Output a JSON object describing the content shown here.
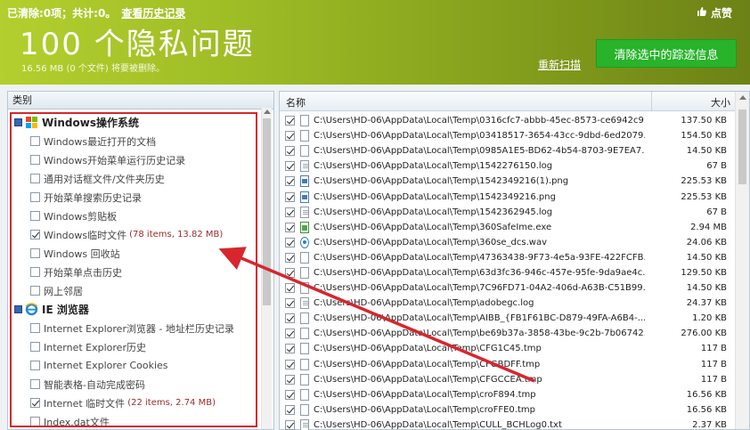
{
  "header": {
    "summary": "已清除:0项；共计:0。",
    "history_link": "查看历史记录",
    "title": "100 个隐私问题",
    "subtext": "16.56 MB (0 个文件) 将要被删除。",
    "like_label": "点赞",
    "rescan_label": "重新扫描",
    "clean_button": "清除选中的踪迹信息"
  },
  "left_panel": {
    "header": "类别",
    "groups": [
      {
        "label": "Windows操作系统",
        "icon": "windows-logo-icon",
        "items": [
          {
            "label": "Windows最近打开的文档",
            "checked": false,
            "count": ""
          },
          {
            "label": "Windows开始菜单运行历史记录",
            "checked": false,
            "count": ""
          },
          {
            "label": "通用对话框文件/文件夹历史",
            "checked": false,
            "count": ""
          },
          {
            "label": "开始菜单搜索历史记录",
            "checked": false,
            "count": ""
          },
          {
            "label": "Windows剪贴板",
            "checked": false,
            "count": ""
          },
          {
            "label": "Windows临时文件",
            "checked": true,
            "count": "(78 items, 13.82 MB)"
          },
          {
            "label": "Windows 回收站",
            "checked": false,
            "count": ""
          },
          {
            "label": "开始菜单点击历史",
            "checked": false,
            "count": ""
          },
          {
            "label": "网上邻居",
            "checked": false,
            "count": ""
          }
        ]
      },
      {
        "label": "IE 浏览器",
        "icon": "internet-explorer-icon",
        "items": [
          {
            "label": "Internet Explorer浏览器 - 地址栏历史记录",
            "checked": false,
            "count": ""
          },
          {
            "label": "Internet Explorer历史",
            "checked": false,
            "count": ""
          },
          {
            "label": "Internet Explorer Cookies",
            "checked": false,
            "count": ""
          },
          {
            "label": "智能表格-自动完成密码",
            "checked": false,
            "count": ""
          },
          {
            "label": "Internet 临时文件",
            "checked": true,
            "count": "(22 items, 2.74 MB)"
          },
          {
            "label": "Index.dat文件",
            "checked": false,
            "count": ""
          }
        ]
      }
    ]
  },
  "right_panel": {
    "col_name": "名称",
    "col_size": "大小",
    "rows": [
      {
        "path": "C:\\Users\\HD-06\\AppData\\Local\\Temp\\0316cfc7-abbb-45ec-8573-ce6942c9...",
        "size": "137.50 KB",
        "icon": "doc"
      },
      {
        "path": "C:\\Users\\HD-06\\AppData\\Local\\Temp\\03418517-3654-43cc-9dbd-6ed2079...",
        "size": "154.50 KB",
        "icon": "doc"
      },
      {
        "path": "C:\\Users\\HD-06\\AppData\\Local\\Temp\\0985A1E5-BD62-4b54-8703-9E7EA7...",
        "size": "14.50 KB",
        "icon": "doc"
      },
      {
        "path": "C:\\Users\\HD-06\\AppData\\Local\\Temp\\1542276150.log",
        "size": "67 B",
        "icon": "txt"
      },
      {
        "path": "C:\\Users\\HD-06\\AppData\\Local\\Temp\\1542349216(1).png",
        "size": "225.53 KB",
        "icon": "img"
      },
      {
        "path": "C:\\Users\\HD-06\\AppData\\Local\\Temp\\1542349216.png",
        "size": "225.53 KB",
        "icon": "img"
      },
      {
        "path": "C:\\Users\\HD-06\\AppData\\Local\\Temp\\1542362945.log",
        "size": "67 B",
        "icon": "txt"
      },
      {
        "path": "C:\\Users\\HD-06\\AppData\\Local\\Temp\\360SafeIme.exe",
        "size": "2.94 MB",
        "icon": "exe"
      },
      {
        "path": "C:\\Users\\HD-06\\AppData\\Local\\Temp\\360se_dcs.wav",
        "size": "24.06 KB",
        "icon": "wav"
      },
      {
        "path": "C:\\Users\\HD-06\\AppData\\Local\\Temp\\47363438-9F73-4e5a-93FE-422FCFB...",
        "size": "14.50 KB",
        "icon": "doc"
      },
      {
        "path": "C:\\Users\\HD-06\\AppData\\Local\\Temp\\63d3fc36-946c-457e-95fe-9da9ae4c...",
        "size": "129.50 KB",
        "icon": "doc"
      },
      {
        "path": "C:\\Users\\HD-06\\AppData\\Local\\Temp\\7C96FD71-04A2-406d-A63B-C51B99...",
        "size": "14.50 KB",
        "icon": "doc"
      },
      {
        "path": "C:\\Users\\HD-06\\AppData\\Local\\Temp\\adobegc.log",
        "size": "24.37 KB",
        "icon": "txt"
      },
      {
        "path": "C:\\Users\\HD-06\\AppData\\Local\\Temp\\AIBB_{FB1F61BC-D879-49FA-A6B4-...",
        "size": "1.20 KB",
        "icon": "doc"
      },
      {
        "path": "C:\\Users\\HD-06\\AppData\\Local\\Temp\\be69b37a-3858-43be-9c2b-7b06742...",
        "size": "276.00 KB",
        "icon": "doc"
      },
      {
        "path": "C:\\Users\\HD-06\\AppData\\Local\\Temp\\CFG1C45.tmp",
        "size": "117 B",
        "icon": "doc"
      },
      {
        "path": "C:\\Users\\HD-06\\AppData\\Local\\Temp\\CFGBDFF.tmp",
        "size": "117 B",
        "icon": "doc"
      },
      {
        "path": "C:\\Users\\HD-06\\AppData\\Local\\Temp\\CFGCCEA.tmp",
        "size": "117 B",
        "icon": "doc"
      },
      {
        "path": "C:\\Users\\HD-06\\AppData\\Local\\Temp\\croF894.tmp",
        "size": "16.56 KB",
        "icon": "doc"
      },
      {
        "path": "C:\\Users\\HD-06\\AppData\\Local\\Temp\\croFFE0.tmp",
        "size": "16.56 KB",
        "icon": "doc"
      },
      {
        "path": "C:\\Users\\HD-06\\AppData\\Local\\Temp\\CULL_BCHLog0.txt",
        "size": "2.37 KB",
        "icon": "txt"
      }
    ]
  },
  "colors": {
    "accent_green": "#28b32a",
    "header_green": "#9fbe26",
    "annotation_red": "#d7262e",
    "count_text": "#9b2a2a"
  }
}
